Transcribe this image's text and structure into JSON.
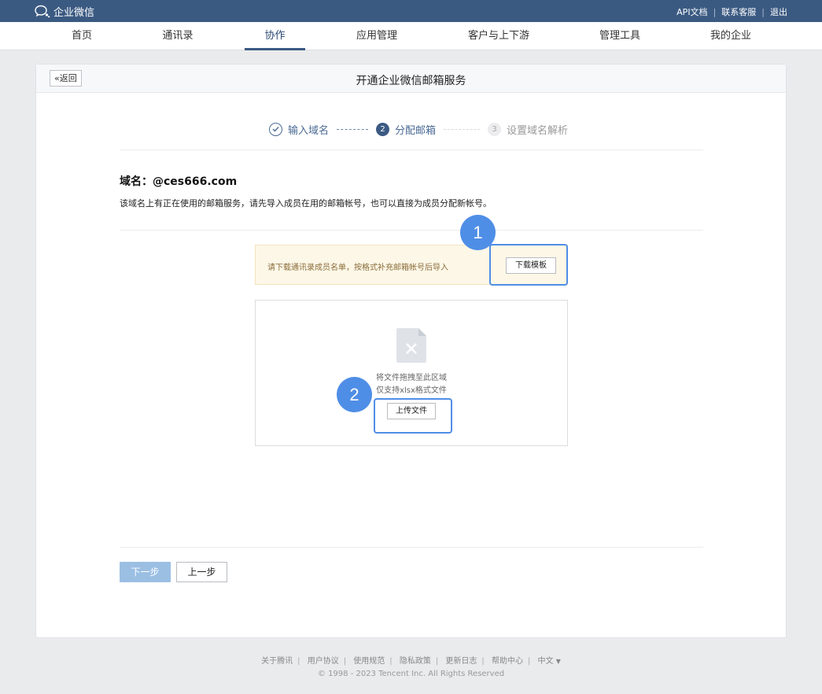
{
  "topbar": {
    "brand": "企业微信",
    "links": [
      "API文档",
      "联系客服",
      "退出"
    ],
    "separator": "|"
  },
  "nav": {
    "items": [
      "首页",
      "通讯录",
      "协作",
      "应用管理",
      "客户与上下游",
      "管理工具",
      "我的企业"
    ],
    "active": "协作"
  },
  "card": {
    "back_label": "返回",
    "title": "开通企业微信邮箱服务"
  },
  "steps": [
    {
      "number": "",
      "label": "输入域名",
      "state": "done"
    },
    {
      "number": "2",
      "label": "分配邮箱",
      "state": "active"
    },
    {
      "number": "3",
      "label": "设置域名解析",
      "state": "pending"
    }
  ],
  "domain": {
    "title": "域名：@ces666.com",
    "description": "该域名上有正在使用的邮箱服务，请先导入成员在用的邮箱帐号，也可以直接为成员分配新帐号。"
  },
  "notice": {
    "text": "请下载通讯录成员名单，按格式补充邮箱帐号后导入",
    "download_button": "下载模板"
  },
  "upload": {
    "hint_line1": "将文件拖拽至此区域",
    "hint_line2": "仅支持xlsx格式文件",
    "button": "上传文件"
  },
  "annotations": {
    "badge1": "1",
    "badge2": "2",
    "color": "#4f8ee6"
  },
  "actions": {
    "next": "下一步",
    "prev": "上一步"
  },
  "footer": {
    "links": [
      "关于腾讯",
      "用户协议",
      "使用规范",
      "隐私政策",
      "更新日志",
      "帮助中心"
    ],
    "language": "中文",
    "copyright": "© 1998 - 2023 Tencent Inc. All Rights Reserved"
  },
  "colors": {
    "header": "#3b5a82",
    "accent": "#4f8ee6",
    "next_disabled": "#9bbfe3"
  }
}
